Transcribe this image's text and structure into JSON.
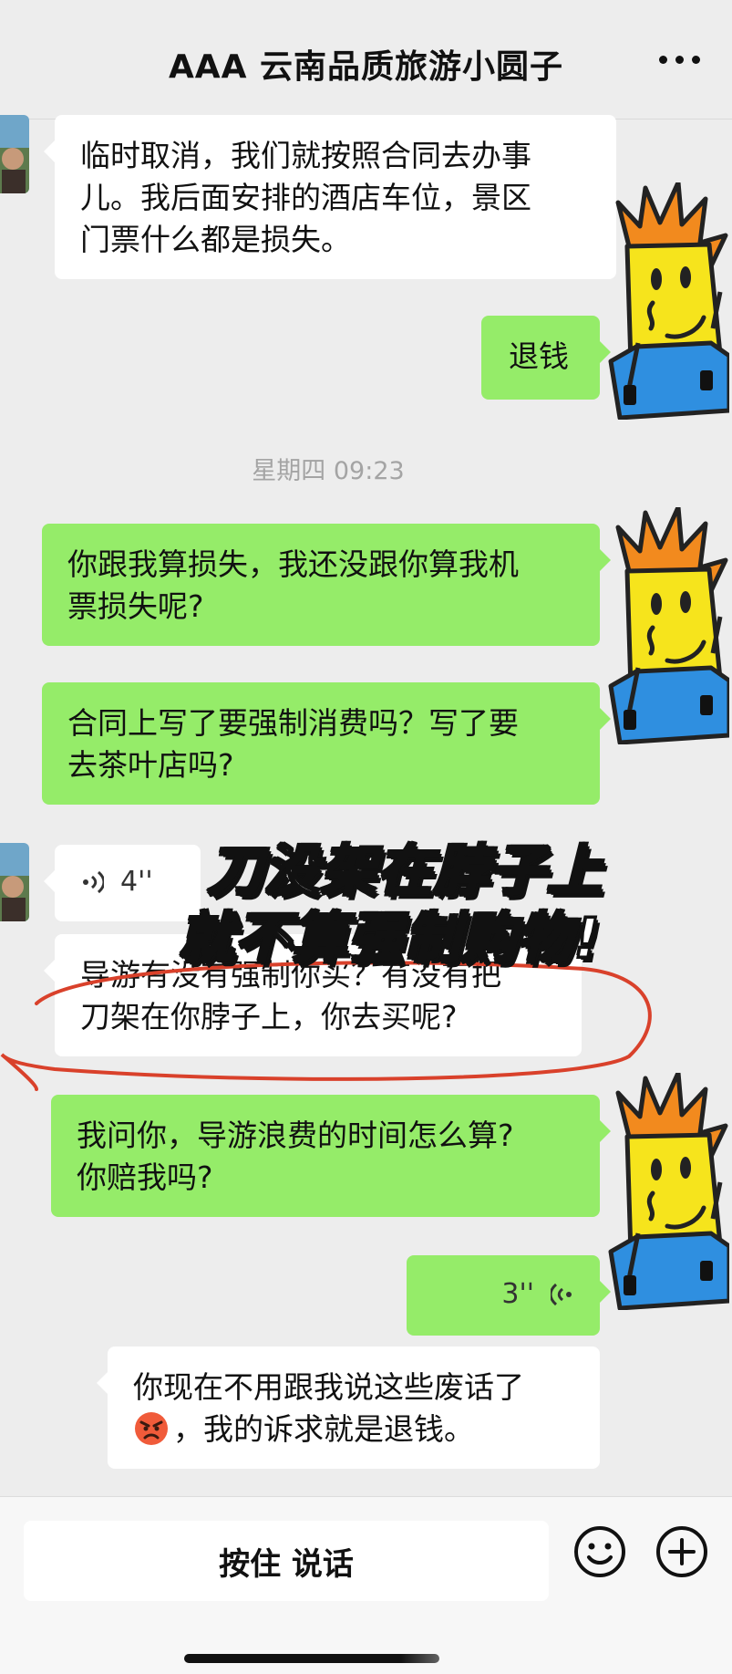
{
  "header": {
    "title": "AAA 云南品质旅游小圆子",
    "more_icon": "more-dots-icon"
  },
  "messages": {
    "m1": {
      "side": "incoming",
      "line1": "临时取消，我们就按照合同去办事",
      "line2": "儿。我后面安排的酒店车位，景区",
      "line3": "门票什么都是损失。"
    },
    "m2": {
      "side": "outgoing",
      "text": "退钱"
    },
    "timestamp": "星期四 09:23",
    "m3": {
      "side": "outgoing",
      "line1": "你跟我算损失，我还没跟你算我机",
      "line2": "票损失呢?"
    },
    "m4": {
      "side": "outgoing",
      "line1": "合同上写了要强制消费吗？写了要",
      "line2": "去茶叶店吗?"
    },
    "m5": {
      "side": "incoming",
      "type": "voice",
      "duration": "4''"
    },
    "m6": {
      "side": "incoming",
      "line1": "导游有没有强制你买？有没有把",
      "line2": "刀架在你脖子上，你去买呢?"
    },
    "m7": {
      "side": "outgoing",
      "line1": "我问你，导游浪费的时间怎么算?",
      "line2": "你赔我吗?"
    },
    "m8": {
      "side": "outgoing",
      "type": "voice",
      "duration": "3''"
    },
    "m9": {
      "side": "outgoing",
      "line1": "你现在不用跟我说这些废话了",
      "line2": "，我的诉求就是退钱。",
      "emoji": "angry-face-emoji"
    }
  },
  "caption": {
    "line1": "刀没架在脖子上",
    "line2": "就不算强制购物!"
  },
  "input_bar": {
    "talk_label": "按住 说话",
    "emoji_icon": "smiley-face-icon",
    "add_icon": "plus-circle-icon"
  },
  "colors": {
    "background": "#ededed",
    "incoming_bubble": "#ffffff",
    "outgoing_bubble": "#95ec69",
    "annotation_red": "#d9412b",
    "sticker_hair": "#f28a1e",
    "sticker_face": "#f6e41c",
    "sticker_shirt": "#2f8fe0"
  }
}
